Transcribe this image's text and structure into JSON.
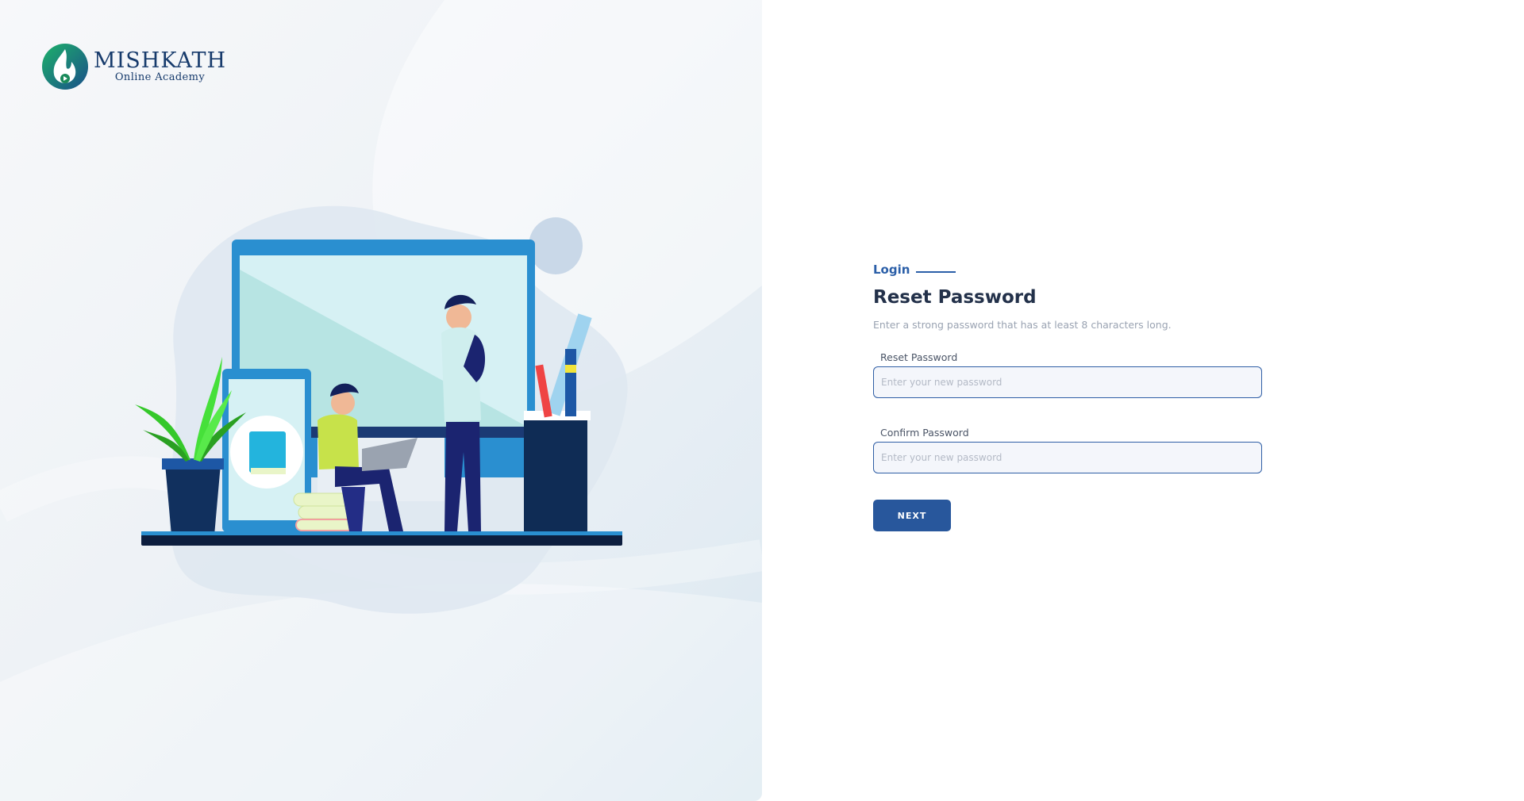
{
  "brand": {
    "title": "MISHKATH",
    "subtitle": "Online Academy"
  },
  "form": {
    "tab_label": "Login",
    "heading": "Reset Password",
    "subtitle": "Enter a strong password that has at least 8 characters long.",
    "reset_password": {
      "label": "Reset Password",
      "placeholder": "Enter your new password",
      "value": ""
    },
    "confirm_password": {
      "label": "Confirm Password",
      "placeholder": "Enter your new password",
      "value": ""
    },
    "next_label": "NEXT"
  },
  "colors": {
    "accent": "#2b5fa8",
    "button": "#28579c",
    "heading": "#23314a",
    "logo_green": "#1a9a5a",
    "logo_navy": "#173b6c"
  },
  "icons": {
    "logo": "flame-play-logo-icon"
  }
}
